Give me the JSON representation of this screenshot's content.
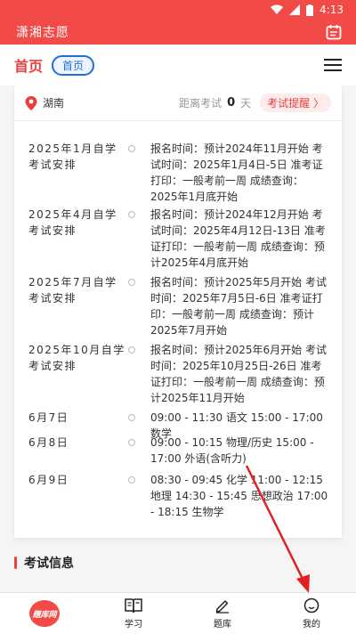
{
  "status": {
    "time": "4:13"
  },
  "app": {
    "title": "潇湘志愿"
  },
  "nav": {
    "title": "首页",
    "tag": "首页"
  },
  "exam_header": {
    "location": "湖南",
    "distance_label": "距离考试",
    "distance_value": "0",
    "distance_unit": "天",
    "remind_button": "考试提醒 〉"
  },
  "schedule": [
    {
      "left": "2025年1月自学考试安排",
      "right": "报名时间：预计2024年11月开始 考试时间：2025年1月4日-5日 准考证打印：一般考前一周 成绩查询：2025年1月底开始"
    },
    {
      "left": "2025年4月自学考试安排",
      "right": "报名时间：预计2024年12月开始 考试时间：2025年4月12日-13日 准考证打印：一般考前一周 成绩查询：预计2025年4月底开始"
    },
    {
      "left": "2025年7月自学考试安排",
      "right": "报名时间：预计2025年5月开始 考试时间：2025年7月5日-6日 准考证打印：一般考前一周 成绩查询：预计2025年7月开始"
    },
    {
      "left": "2025年10月自学考试安排",
      "right": "报名时间：预计2025年6月开始 考试时间：2025年10月25日-26日 准考证打印：一般考前一周 成绩查询：预计2025年11月开始"
    },
    {
      "left": "6月7日",
      "right": "09:00 - 11:30 语文 15:00 - 17:00 数学"
    },
    {
      "left": "6月8日",
      "right": "09:00 - 10:15 物理/历史 15:00 - 17:00 外语(含听力)"
    },
    {
      "left": "6月9日",
      "right": "08:30 - 09:45 化学 11:00 - 12:15 地理 14:30 - 15:45 思想政治 17:00 - 18:15 生物学"
    }
  ],
  "section": {
    "title": "考试信息"
  },
  "bottom_nav": [
    {
      "label": "題库网"
    },
    {
      "label": "学习"
    },
    {
      "label": "题库"
    },
    {
      "label": "我的"
    }
  ],
  "colors": {
    "brand": "#f14a47",
    "accent_blue": "#1f6fd6",
    "arrow": "#e02020"
  }
}
